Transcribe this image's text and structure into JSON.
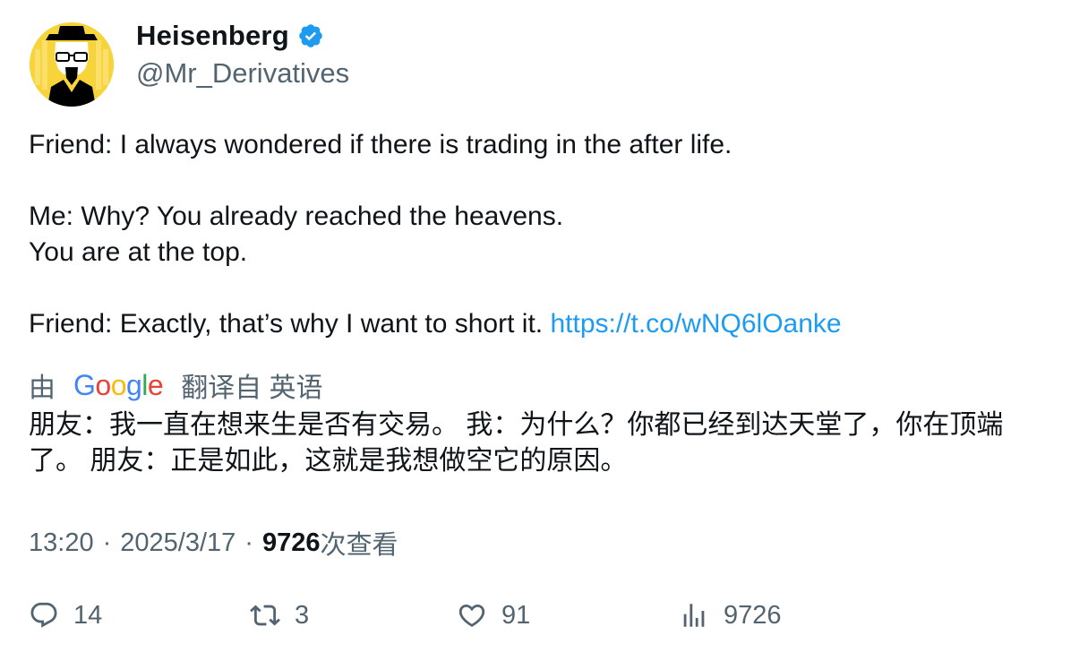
{
  "author": {
    "display_name": "Heisenberg",
    "handle": "@Mr_Derivatives",
    "verified_icon": "verified-badge-icon",
    "avatar_icon": "heisenberg-avatar-icon"
  },
  "tweet": {
    "line1": "Friend: I always wondered if there is trading in the after life.",
    "line2": "Me: Why? You already reached the heavens.",
    "line3": "You are at the top.",
    "line4": "Friend: Exactly, that’s why I want to short it.",
    "link": "https://t.co/wNQ6lOanke"
  },
  "translation": {
    "prefix": "由",
    "provider_letters": [
      "G",
      "o",
      "o",
      "g",
      "l",
      "e"
    ],
    "suffix": "翻译自 英语",
    "text": "朋友：我一直在想来生是否有交易。 我：为什么？你都已经到达天堂了，你在顶端了。 朋友：正是如此，这就是我想做空它的原因。"
  },
  "meta": {
    "time": "13:20",
    "sep1": "·",
    "date": "2025/3/17",
    "sep2": "·",
    "views_number": "9726",
    "views_label": "次查看"
  },
  "actions": {
    "replies": "14",
    "retweets": "3",
    "likes": "91",
    "views": "9726"
  },
  "colors": {
    "accent": "#1d9bf0",
    "muted": "#536471",
    "text": "#0f1419"
  }
}
